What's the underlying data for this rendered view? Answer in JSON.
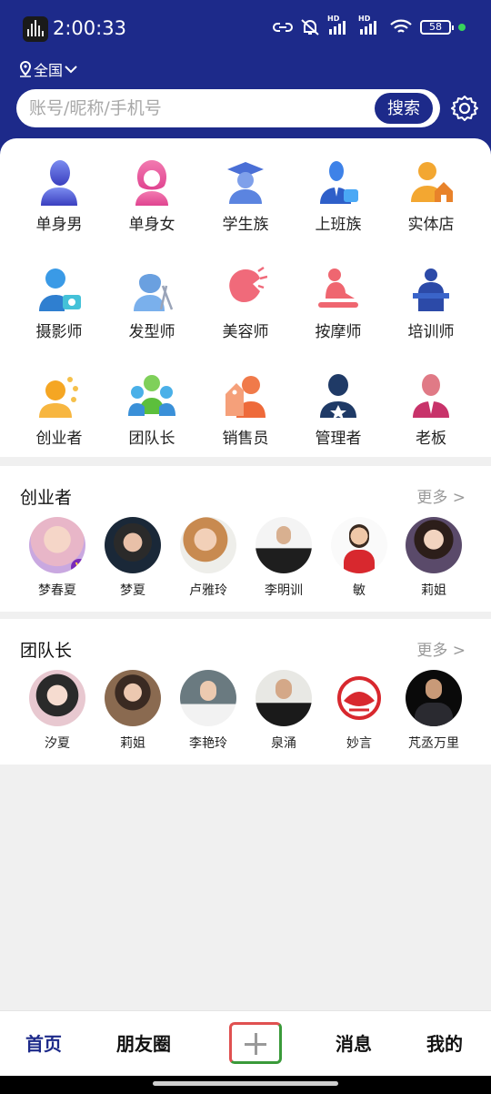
{
  "status_bar": {
    "time": "2:00:33",
    "battery": "58",
    "signal_label_1": "HD",
    "signal_label_2": "HD"
  },
  "header": {
    "location": "全国",
    "search": {
      "placeholder": "账号/昵称/手机号",
      "button_label": "搜索"
    }
  },
  "categories": [
    {
      "label": "单身男",
      "icon": "single-man-icon"
    },
    {
      "label": "单身女",
      "icon": "single-woman-icon"
    },
    {
      "label": "学生族",
      "icon": "student-icon"
    },
    {
      "label": "上班族",
      "icon": "office-worker-icon"
    },
    {
      "label": "实体店",
      "icon": "store-icon"
    },
    {
      "label": "摄影师",
      "icon": "photographer-icon"
    },
    {
      "label": "发型师",
      "icon": "hairstylist-icon"
    },
    {
      "label": "美容师",
      "icon": "beautician-icon"
    },
    {
      "label": "按摩师",
      "icon": "masseur-icon"
    },
    {
      "label": "培训师",
      "icon": "trainer-icon"
    },
    {
      "label": "创业者",
      "icon": "entrepreneur-icon"
    },
    {
      "label": "团队长",
      "icon": "team-leader-icon"
    },
    {
      "label": "销售员",
      "icon": "salesperson-icon"
    },
    {
      "label": "管理者",
      "icon": "manager-icon"
    },
    {
      "label": "老板",
      "icon": "boss-icon"
    }
  ],
  "sections": [
    {
      "title": "创业者",
      "more": "更多 >",
      "people": [
        {
          "name": "梦春夏"
        },
        {
          "name": "梦夏"
        },
        {
          "name": "卢雅玲"
        },
        {
          "name": "李明训"
        },
        {
          "name": "敏"
        },
        {
          "name": "莉姐"
        }
      ]
    },
    {
      "title": "团队长",
      "more": "更多 >",
      "people": [
        {
          "name": "汐夏"
        },
        {
          "name": "莉姐"
        },
        {
          "name": "李艳玲"
        },
        {
          "name": "泉涌"
        },
        {
          "name": "妙言"
        },
        {
          "name": "芃丞万里"
        }
      ]
    }
  ],
  "bottom_nav": {
    "home": "首页",
    "moments": "朋友圈",
    "add": "plus-icon",
    "messages": "消息",
    "me": "我的"
  },
  "colors": {
    "brand": "#1d2a8a",
    "accent_orange": "#f0a030",
    "accent_pink": "#e8557a"
  }
}
